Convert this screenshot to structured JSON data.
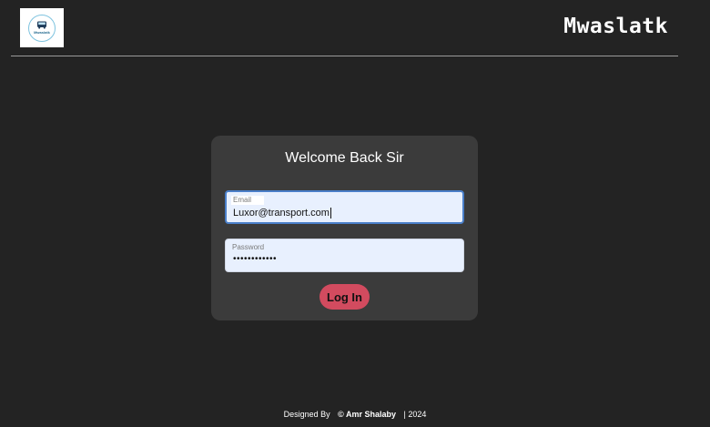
{
  "header": {
    "logo_text": "Mwaslatk",
    "brand": "Mwaslatk"
  },
  "login": {
    "title": "Welcome Back Sir",
    "email": {
      "label": "Email",
      "value": "Luxor@transport.com"
    },
    "password": {
      "label": "Password",
      "masked_value": "••••••••••••"
    },
    "submit_label": "Log In"
  },
  "footer": {
    "designed_by": "Designed By",
    "author": "© Amr Shalaby",
    "year": "| 2024"
  },
  "colors": {
    "background": "#232323",
    "card": "#3b3b3b",
    "input_fill": "#e8f0fe",
    "focus_border": "#4a7fc9",
    "button": "#d24b5f"
  }
}
